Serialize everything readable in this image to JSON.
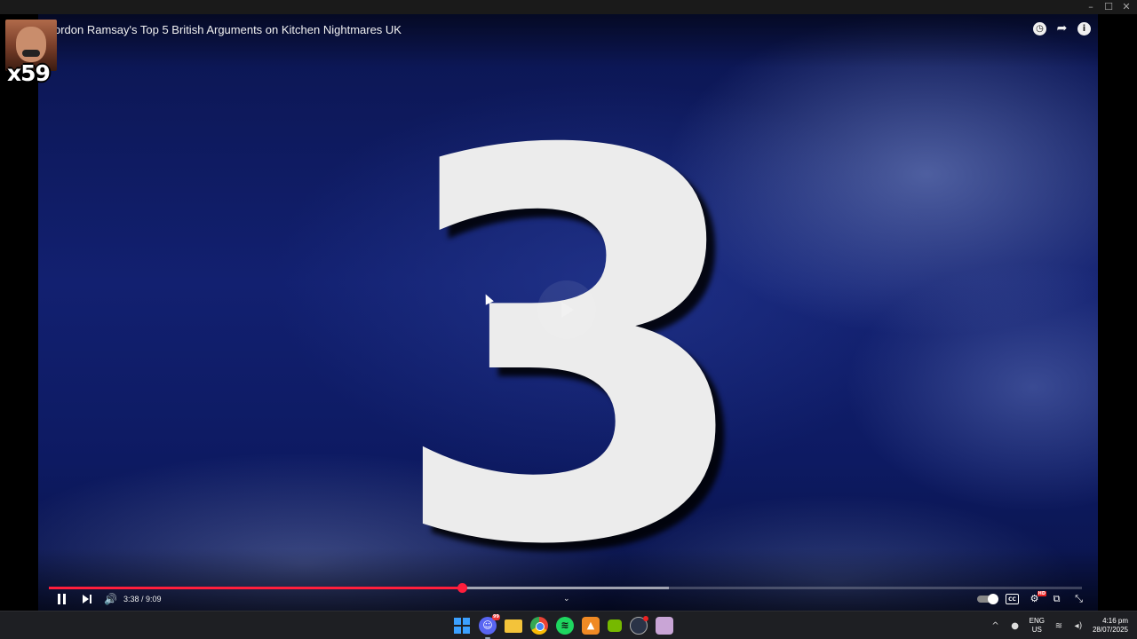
{
  "window": {
    "minimize": "–",
    "maximize": "☐",
    "close": "✕"
  },
  "video": {
    "title": "ordon Ramsay's Top 5 British Arguments on Kitchen Nightmares UK",
    "frame_number": "3",
    "top_icons": {
      "watch_later": "◷",
      "share": "➦",
      "info": "i"
    }
  },
  "overlay": {
    "count": "x59"
  },
  "player": {
    "current_time": "3:38",
    "separator": " / ",
    "duration": "9:09",
    "time_display": "3:38 / 9:09",
    "progress_fraction": 0.4,
    "buffered_fraction": 0.6,
    "chevron": "⌄"
  },
  "controls_right": {
    "subtitles": "CC",
    "settings": "⚙",
    "cast": "⧉",
    "fullscreen_exit": "⤡"
  },
  "taskbar": {
    "discord_badge": "99",
    "language": "ENG",
    "region": "US",
    "time": "4:16 pm",
    "date": "28/07/2025",
    "tray_icons": {
      "chevron": "^",
      "mic": "🎙",
      "wifi": "≋",
      "volume": "🔊"
    }
  },
  "colors": {
    "progress": "#ff1e3c",
    "video_bg": "#122070",
    "taskbar": "#1e1f23"
  }
}
